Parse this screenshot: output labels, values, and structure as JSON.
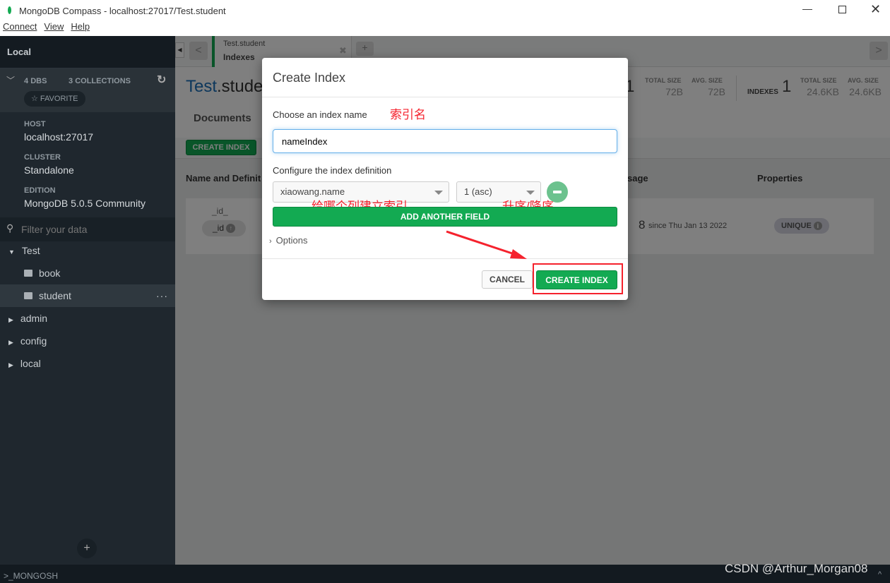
{
  "window": {
    "title": "MongoDB Compass - localhost:27017/Test.student"
  },
  "menu": [
    "Connect",
    "View",
    "Help"
  ],
  "sidebar": {
    "title": "Local",
    "dbs_count": "4",
    "dbs_label": "DBS",
    "collections_count": "3",
    "collections_label": "COLLECTIONS",
    "favorite": "☆ FAVORITE",
    "host_label": "HOST",
    "host": "localhost:27017",
    "cluster_label": "CLUSTER",
    "cluster": "Standalone",
    "edition_label": "EDITION",
    "edition": "MongoDB 5.0.5 Community",
    "filter_placeholder": "Filter your data",
    "databases": [
      {
        "name": "Test",
        "collections": [
          "book",
          "student"
        ]
      },
      {
        "name": "admin"
      },
      {
        "name": "config"
      },
      {
        "name": "local"
      }
    ]
  },
  "tab": {
    "namespace": "Test.student",
    "subtitle": "Indexes"
  },
  "header": {
    "db": "Test",
    "collection": ".studen",
    "docs_count": "1",
    "total_size_label": "TOTAL SIZE",
    "total_size": "72B",
    "avg_size_label": "AVG. SIZE",
    "avg_size": "72B",
    "indexes_label": "INDEXES",
    "indexes_count": "1",
    "idx_total_size": "24.6KB",
    "idx_avg_size": "24.6KB"
  },
  "subtabs": {
    "documents": "Documents"
  },
  "toolbar": {
    "create_index": "CREATE INDEX"
  },
  "table": {
    "col_name": "Name and Definit",
    "col_usage": "sage",
    "col_properties": "Properties",
    "row": {
      "name": "_id_",
      "field": "_id",
      "usage_count": "8",
      "usage_since": "since Thu Jan 13 2022",
      "property": "UNIQUE"
    }
  },
  "modal": {
    "title": "Create Index",
    "name_label": "Choose an index name",
    "name_value": "nameIndex",
    "definition_label": "Configure the index definition",
    "field_value": "xiaowang.name",
    "direction_value": "1 (asc)",
    "add_field": "ADD ANOTHER FIELD",
    "options": "Options",
    "cancel": "CANCEL",
    "create": "CREATE INDEX"
  },
  "annotations": {
    "name": "索引名",
    "field": "给哪个列建立索引",
    "direction": "升序/降序"
  },
  "bottom": {
    "shell": ">_MONGOSH"
  },
  "watermark": "CSDN @Arthur_Morgan08",
  "colors": {
    "accent": "#13aa52",
    "sidebar": "#1f272e",
    "annotation": "#f5222d"
  }
}
